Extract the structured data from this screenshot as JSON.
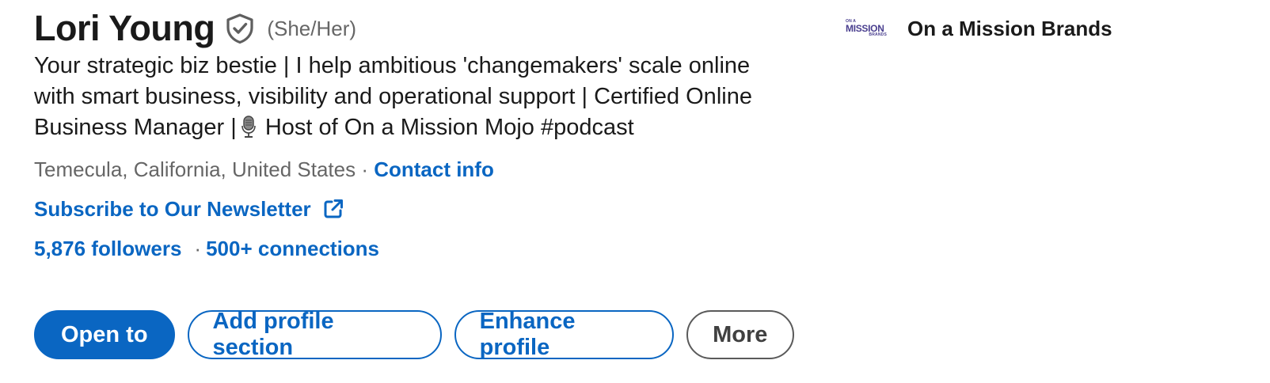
{
  "profile": {
    "name": "Lori Young",
    "pronouns": "(She/Her)",
    "headline_part1": "Your strategic biz bestie | I help ambitious 'changemakers' scale online with smart business, visibility and operational support | Certified Online Business Manager |",
    "headline_part2": " Host of On a Mission Mojo #podcast",
    "location": "Temecula, California, United States",
    "location_separator": " · ",
    "contact_info": "Contact info",
    "newsletter_link": "Subscribe to Our Newsletter",
    "followers": "5,876 followers",
    "stats_separator": "·",
    "connections": "500+ connections"
  },
  "actions": {
    "open_to": "Open to",
    "add_profile_section": "Add profile section",
    "enhance_profile": "Enhance profile",
    "more": "More"
  },
  "company": {
    "logo_small_text": "ON A",
    "logo_big_text": "MISSION",
    "logo_tiny_text": "BRANDS",
    "name": "On a Mission Brands"
  },
  "icons": {
    "verified": "verified-shield-icon",
    "microphone": "microphone-icon",
    "external_link": "external-link-icon"
  },
  "colors": {
    "link_blue": "#0a66c2",
    "text_dark": "#1a1a1a",
    "text_muted": "#666666",
    "logo_purple": "#4a3f8f"
  }
}
